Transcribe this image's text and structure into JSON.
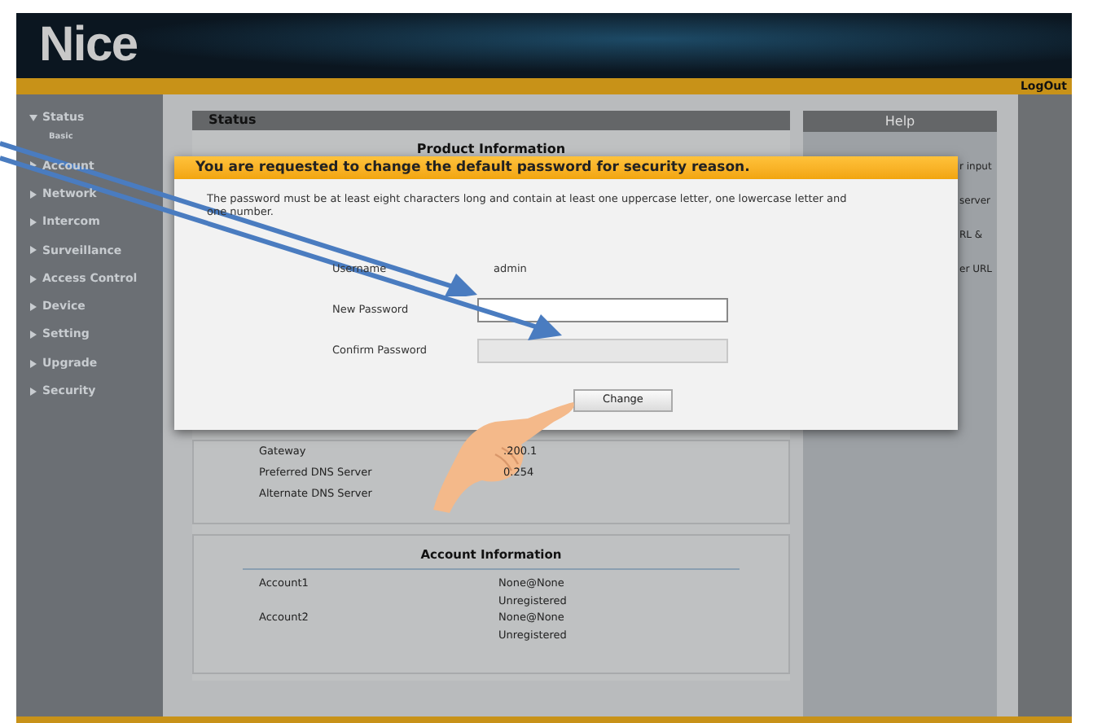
{
  "header": {
    "logo": "Nice",
    "logout": "LogOut"
  },
  "sidebar": {
    "items": [
      {
        "label": "Status",
        "expanded": true,
        "children": [
          {
            "label": "Basic"
          }
        ]
      },
      {
        "label": "Account",
        "expanded": false
      },
      {
        "label": "Network",
        "expanded": false
      },
      {
        "label": "Intercom",
        "expanded": false
      },
      {
        "label": "Surveillance",
        "expanded": false
      },
      {
        "label": "Access Control",
        "expanded": false
      },
      {
        "label": "Device",
        "expanded": false
      },
      {
        "label": "Setting",
        "expanded": false
      },
      {
        "label": "Upgrade",
        "expanded": false
      },
      {
        "label": "Security",
        "expanded": false
      }
    ]
  },
  "status": {
    "title": "Status",
    "product_heading": "Product Information",
    "network_rows": [
      {
        "label": "Gateway",
        "value": ".200.1"
      },
      {
        "label": "Preferred DNS Server",
        "value": "0.254"
      },
      {
        "label": "Alternate DNS Server"
      }
    ],
    "account_heading": "Account Information",
    "accounts": [
      {
        "label": "Account1",
        "lines": [
          "None@None",
          "Unregistered"
        ]
      },
      {
        "label": "Account2",
        "lines": [
          "None@None",
          "Unregistered"
        ]
      }
    ]
  },
  "help": {
    "title": "Help",
    "fragments": [
      "r input",
      "server",
      "RL &",
      "er URL"
    ]
  },
  "dialog": {
    "title": "You are requested to change the default password for security reason.",
    "message": "The password must be at least eight characters long and contain at least one uppercase letter, one lowercase letter and one number.",
    "fields": [
      {
        "label": "Username",
        "kind": "text",
        "value": "admin"
      },
      {
        "label": "New Password",
        "kind": "input",
        "disabled": false
      },
      {
        "label": "Confirm Password",
        "kind": "input",
        "disabled": true
      }
    ],
    "button": "Change"
  }
}
